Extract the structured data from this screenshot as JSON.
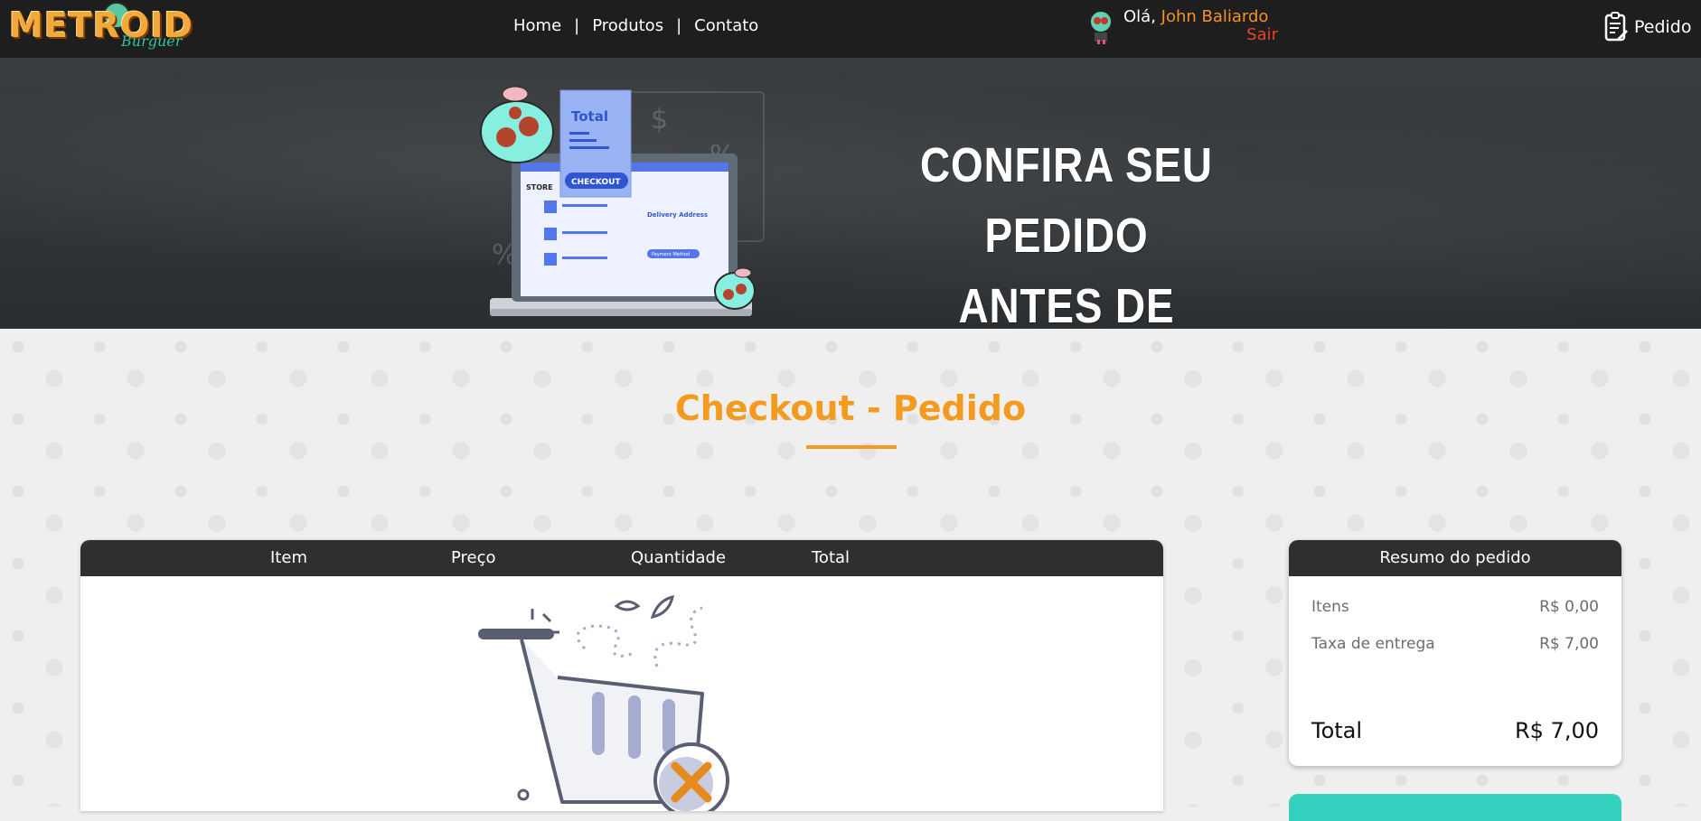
{
  "brand": {
    "logo_main": "METROID",
    "logo_sub": "Burguer"
  },
  "nav": {
    "links": [
      "Home",
      "Produtos",
      "Contato"
    ],
    "separator": "|"
  },
  "user": {
    "greeting": "Olá, ",
    "name": "John Baliardo",
    "logout": "Sair",
    "avatar_icon": "metroid-avatar-icon"
  },
  "order_link": {
    "label": "Pedido",
    "icon": "order-list-icon"
  },
  "banner": {
    "headline_line1": "CONFIRA SEU PEDIDO",
    "headline_line2": "ANTES DE CONTINUAR",
    "illustration": {
      "total_label": "Total",
      "checkout_label": "CHECKOUT",
      "store_label": "STORE",
      "delivery_label": "Delivery Address",
      "payment_label": "Payment Method",
      "dollar_sign": "$",
      "percent_sign": "%"
    }
  },
  "page": {
    "title": "Checkout - Pedido"
  },
  "cart_table": {
    "columns": [
      "Item",
      "Preço",
      "Quantidade",
      "Total"
    ],
    "empty_icon": "empty-cart-icon"
  },
  "summary": {
    "title": "Resumo do pedido",
    "rows": [
      {
        "label": "Itens",
        "value": "R$ 0,00"
      },
      {
        "label": "Taxa de entrega",
        "value": "R$ 7,00"
      }
    ],
    "total_label": "Total",
    "total_value": "R$ 7,00"
  },
  "colors": {
    "accent_orange": "#f39b1f",
    "logout_red": "#e8432c",
    "teal_button": "#34d1bf",
    "dark_header": "#2f2f2f"
  }
}
